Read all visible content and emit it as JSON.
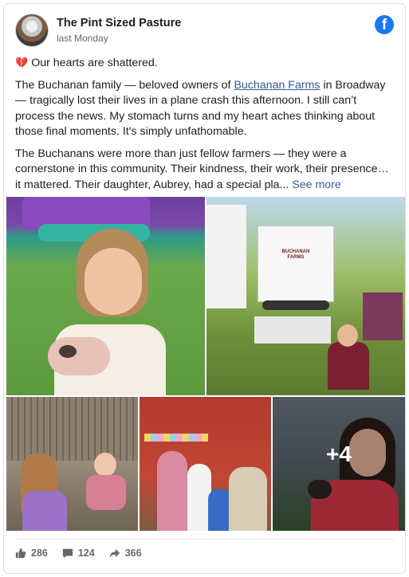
{
  "post": {
    "page_name": "The Pint Sized Pasture",
    "timestamp": "last Monday",
    "brand_color": "#1877f2",
    "link_color": "#385898",
    "heart_icon": "broken-heart-emoji",
    "heading": "Our hearts are shattered.",
    "para1_before": "The Buchanan family — beloved owners of ",
    "para1_link": "Buchanan Farms",
    "para1_after": " in Broadway — tragically lost their lives in a plane crash this afternoon. I still can’t process the news. My stomach turns and my heart aches thinking about those final moments. It's simply unfathomable.",
    "para2": "The Buchanans were more than just fellow farmers — they were a cornerstone in this community. Their kindness, their work, their presence… it mattered. Their daughter, Aubrey, had a special pla...",
    "see_more": "See more"
  },
  "photos": {
    "truck_sign": "BUCHANAN FARMS",
    "more_count": "+4"
  },
  "stats": {
    "likes": "286",
    "comments": "124",
    "shares": "366"
  }
}
